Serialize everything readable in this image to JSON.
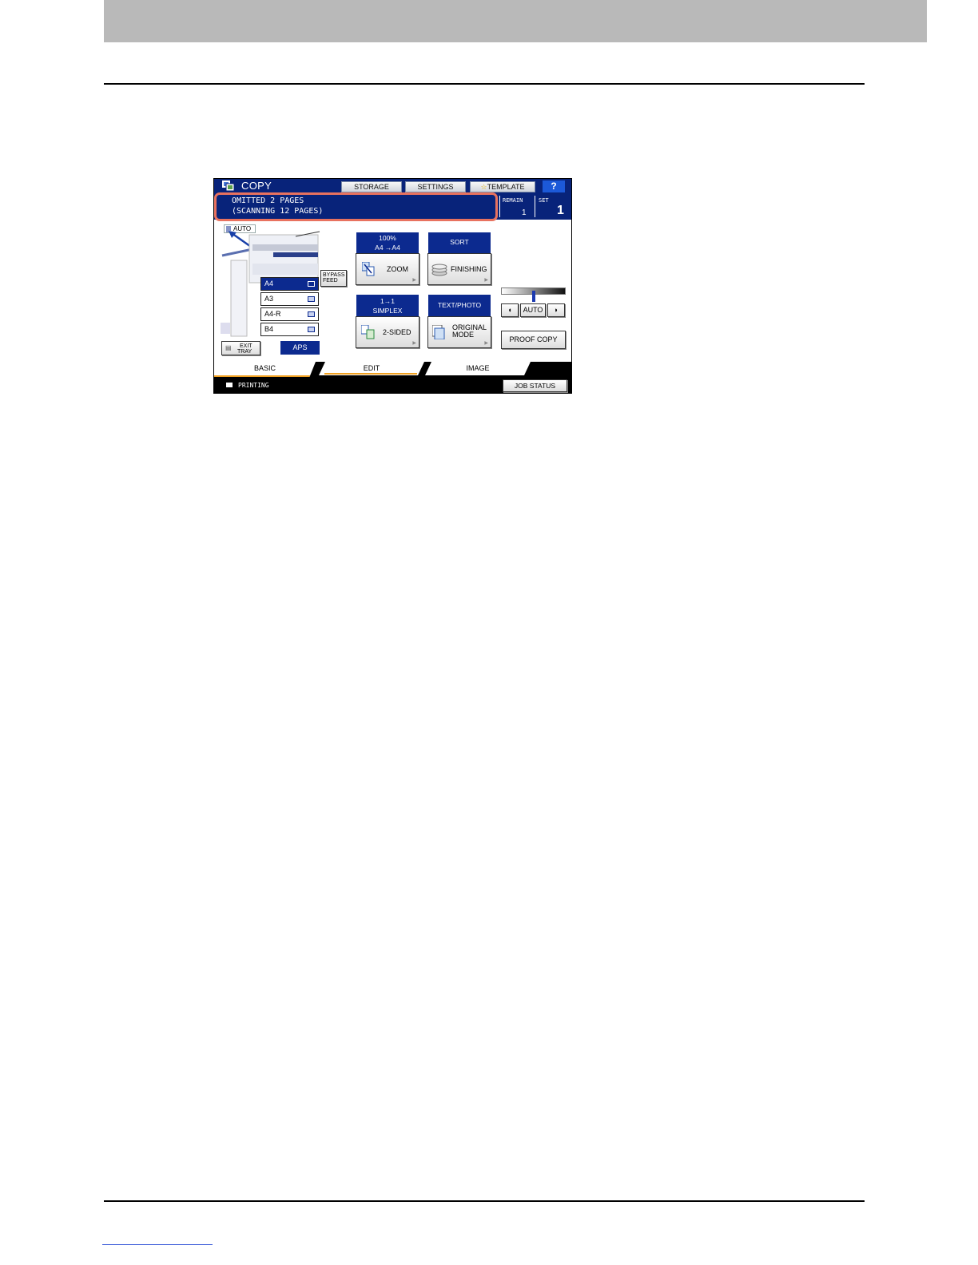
{
  "copier": {
    "title": "COPY",
    "top_buttons": {
      "storage": "STORAGE",
      "settings": "SETTINGS",
      "template": "TEMPLATE",
      "help": "?"
    },
    "message": {
      "line1": "OMITTED 2 PAGES",
      "line2": "(SCANNING 12 PAGES)"
    },
    "remain": {
      "label": "REMAIN",
      "value": "1"
    },
    "set": {
      "label": "SET",
      "value": "1"
    },
    "auto_label": "AUTO",
    "paper_trays": [
      {
        "label": "A4",
        "selected": true
      },
      {
        "label": "A3",
        "selected": false
      },
      {
        "label": "A4-R",
        "selected": false
      },
      {
        "label": "B4",
        "selected": false
      }
    ],
    "bypass_feed": {
      "line1": "BYPASS",
      "line2": "FEED"
    },
    "exit_tray": {
      "line1": "EXIT",
      "line2": "TRAY"
    },
    "aps": "APS",
    "zoom": {
      "head1": "100%",
      "head2": "A4  →A4",
      "label": "ZOOM"
    },
    "finishing": {
      "head": "SORT",
      "label": "FINISHING"
    },
    "two_sided": {
      "head1": "1→1",
      "head2": "SIMPLEX",
      "label": "2-SIDED"
    },
    "original_mode": {
      "head": "TEXT/PHOTO",
      "line1": "ORIGINAL",
      "line2": "MODE"
    },
    "density": {
      "auto": "AUTO",
      "level": 0.5
    },
    "proof_copy": "PROOF COPY",
    "tabs": {
      "basic": "BASIC",
      "edit": "EDIT",
      "image": "IMAGE"
    },
    "status": "PRINTING",
    "job_status": "JOB STATUS",
    "colors": {
      "panel_blue": "#08237a",
      "highlight": "#e8725f",
      "accent_orange": "#f0a020"
    }
  }
}
